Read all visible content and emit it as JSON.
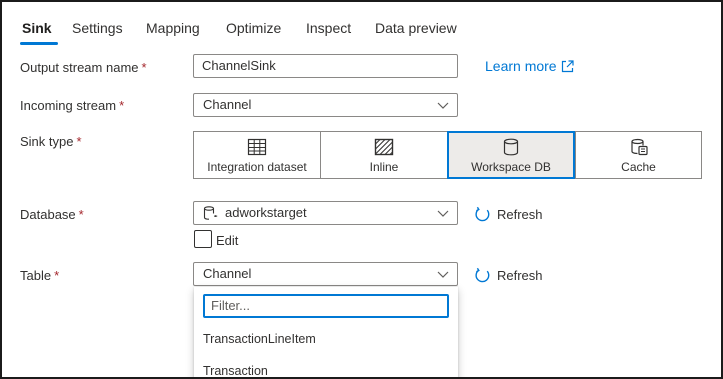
{
  "tabs": [
    {
      "label": "Sink",
      "active": true
    },
    {
      "label": "Settings",
      "active": false
    },
    {
      "label": "Mapping",
      "active": false
    },
    {
      "label": "Optimize",
      "active": false
    },
    {
      "label": "Inspect",
      "active": false
    },
    {
      "label": "Data preview",
      "active": false
    }
  ],
  "fields": {
    "output_stream_name": {
      "label": "Output stream name",
      "required_mark": "*",
      "value": "ChannelSink"
    },
    "incoming_stream": {
      "label": "Incoming stream",
      "required_mark": "*",
      "value": "Channel"
    },
    "sink_type": {
      "label": "Sink type",
      "required_mark": "*"
    },
    "database": {
      "label": "Database",
      "required_mark": "*",
      "value": "adworkstarget",
      "edit_label": "Edit",
      "edit_checked": false
    },
    "table": {
      "label": "Table",
      "required_mark": "*",
      "value": "Channel"
    }
  },
  "learn_more": {
    "label": "Learn more",
    "icon": "external-link-icon"
  },
  "sink_types": [
    {
      "label": "Integration dataset",
      "icon": "table-grid-icon",
      "selected": false
    },
    {
      "label": "Inline",
      "icon": "hatched-box-icon",
      "selected": false
    },
    {
      "label": "Workspace DB",
      "icon": "database-icon",
      "selected": true
    },
    {
      "label": "Cache",
      "icon": "cache-icon",
      "selected": false
    }
  ],
  "refresh_label": "Refresh",
  "table_dropdown": {
    "filter_placeholder": "Filter...",
    "options": [
      "TransactionLineItem",
      "Transaction"
    ]
  },
  "colors": {
    "accent": "#0078d4",
    "required": "#a4262c",
    "selected_bg": "#edebe9"
  }
}
